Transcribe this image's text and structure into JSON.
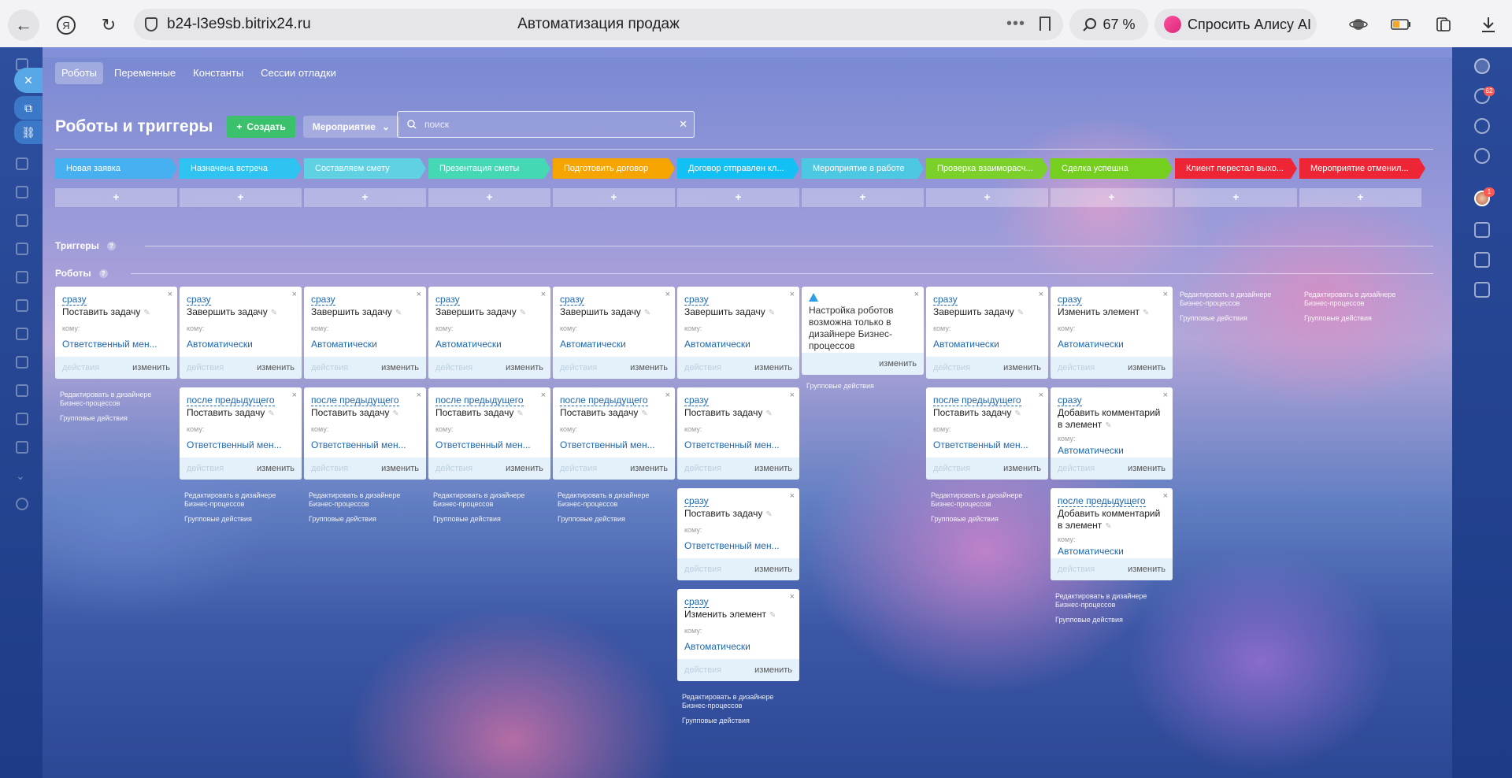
{
  "browser": {
    "url": "b24-l3e9sb.bitrix24.ru",
    "tab_title": "Автоматизация продаж",
    "zoom": "67 %",
    "alice_label": "Спросить Алису AI"
  },
  "left_dock": {
    "close_icon": "×"
  },
  "right_dock": {
    "notifications_count": "62",
    "avatar_badge": "1"
  },
  "tabs": [
    {
      "label": "Роботы",
      "active": true
    },
    {
      "label": "Переменные"
    },
    {
      "label": "Константы"
    },
    {
      "label": "Сессии отладки"
    }
  ],
  "toolbar": {
    "title": "Роботы и триггеры",
    "create_label": "Создать",
    "event_label": "Мероприятие",
    "search_placeholder": "поиск"
  },
  "stages": [
    {
      "label": "Новая заявка",
      "color": "#47b0f0"
    },
    {
      "label": "Назначена встреча",
      "color": "#2ec3f0"
    },
    {
      "label": "Составляем смету",
      "color": "#5fd1e3"
    },
    {
      "label": "Презентация сметы",
      "color": "#45d8b5"
    },
    {
      "label": "Подготовить договор",
      "color": "#f6a400"
    },
    {
      "label": "Договор отправлен кл...",
      "color": "#12c0f4"
    },
    {
      "label": "Мероприятие в работе",
      "color": "#4cc8e3"
    },
    {
      "label": "Проверка взаиморасч...",
      "color": "#7bd12a"
    },
    {
      "label": "Сделка успешна",
      "color": "#74cf1f"
    },
    {
      "label": "Клиент перестал выхо...",
      "color": "#ee2535"
    },
    {
      "label": "Мероприятие отменил...",
      "color": "#ee2535"
    }
  ],
  "sections": {
    "triggers": "Триггеры",
    "robots": "Роботы"
  },
  "labels": {
    "to_whom": "кому:",
    "actions": "действия",
    "edit": "изменить",
    "edit_in_designer": "Редактировать в дизайнере Бизнес-процессов",
    "group_actions": "Групповые действия"
  },
  "robot_columns": [
    {
      "cards": [
        {
          "condition": "сразу",
          "title": "Поставить задачу",
          "assignee": "Ответственный мен..."
        }
      ]
    },
    {
      "cards": [
        {
          "condition": "сразу",
          "title": "Завершить задачу",
          "assignee": "Автоматически"
        },
        {
          "condition": "после предыдущего",
          "title": "Поставить задачу",
          "assignee": "Ответственный мен..."
        }
      ]
    },
    {
      "cards": [
        {
          "condition": "сразу",
          "title": "Завершить задачу",
          "assignee": "Автоматически"
        },
        {
          "condition": "после предыдущего",
          "title": "Поставить задачу",
          "assignee": "Ответственный мен..."
        }
      ]
    },
    {
      "cards": [
        {
          "condition": "сразу",
          "title": "Завершить задачу",
          "assignee": "Автоматически"
        },
        {
          "condition": "после предыдущего",
          "title": "Поставить задачу",
          "assignee": "Ответственный мен..."
        }
      ]
    },
    {
      "cards": [
        {
          "condition": "сразу",
          "title": "Завершить задачу",
          "assignee": "Автоматически"
        },
        {
          "condition": "после предыдущего",
          "title": "Поставить задачу",
          "assignee": "Ответственный мен..."
        }
      ]
    },
    {
      "cards": [
        {
          "condition": "сразу",
          "title": "Завершить задачу",
          "assignee": "Автоматически"
        },
        {
          "condition": "сразу",
          "title": "Поставить задачу",
          "assignee": "Ответственный мен..."
        },
        {
          "condition": "сразу",
          "title": "Поставить задачу",
          "assignee": "Ответственный мен..."
        },
        {
          "condition": "сразу",
          "title": "Изменить элемент",
          "assignee": "Автоматически"
        }
      ]
    },
    {
      "warning": "Настройка роботов возможна только в дизайнере Бизнес-процессов",
      "cards": []
    },
    {
      "cards": [
        {
          "condition": "сразу",
          "title": "Завершить задачу",
          "assignee": "Автоматически"
        },
        {
          "condition": "после предыдущего",
          "title": "Поставить задачу",
          "assignee": "Ответственный мен..."
        }
      ]
    },
    {
      "cards": [
        {
          "condition": "сразу",
          "title": "Изменить элемент",
          "assignee": "Автоматически"
        },
        {
          "condition": "сразу",
          "title": "Добавить комментарий в элемент",
          "assignee": "Автоматически"
        },
        {
          "condition": "после предыдущего",
          "title": "Добавить комментарий в элемент",
          "assignee": "Автоматически"
        }
      ]
    },
    {
      "cards": []
    },
    {
      "cards": []
    }
  ]
}
